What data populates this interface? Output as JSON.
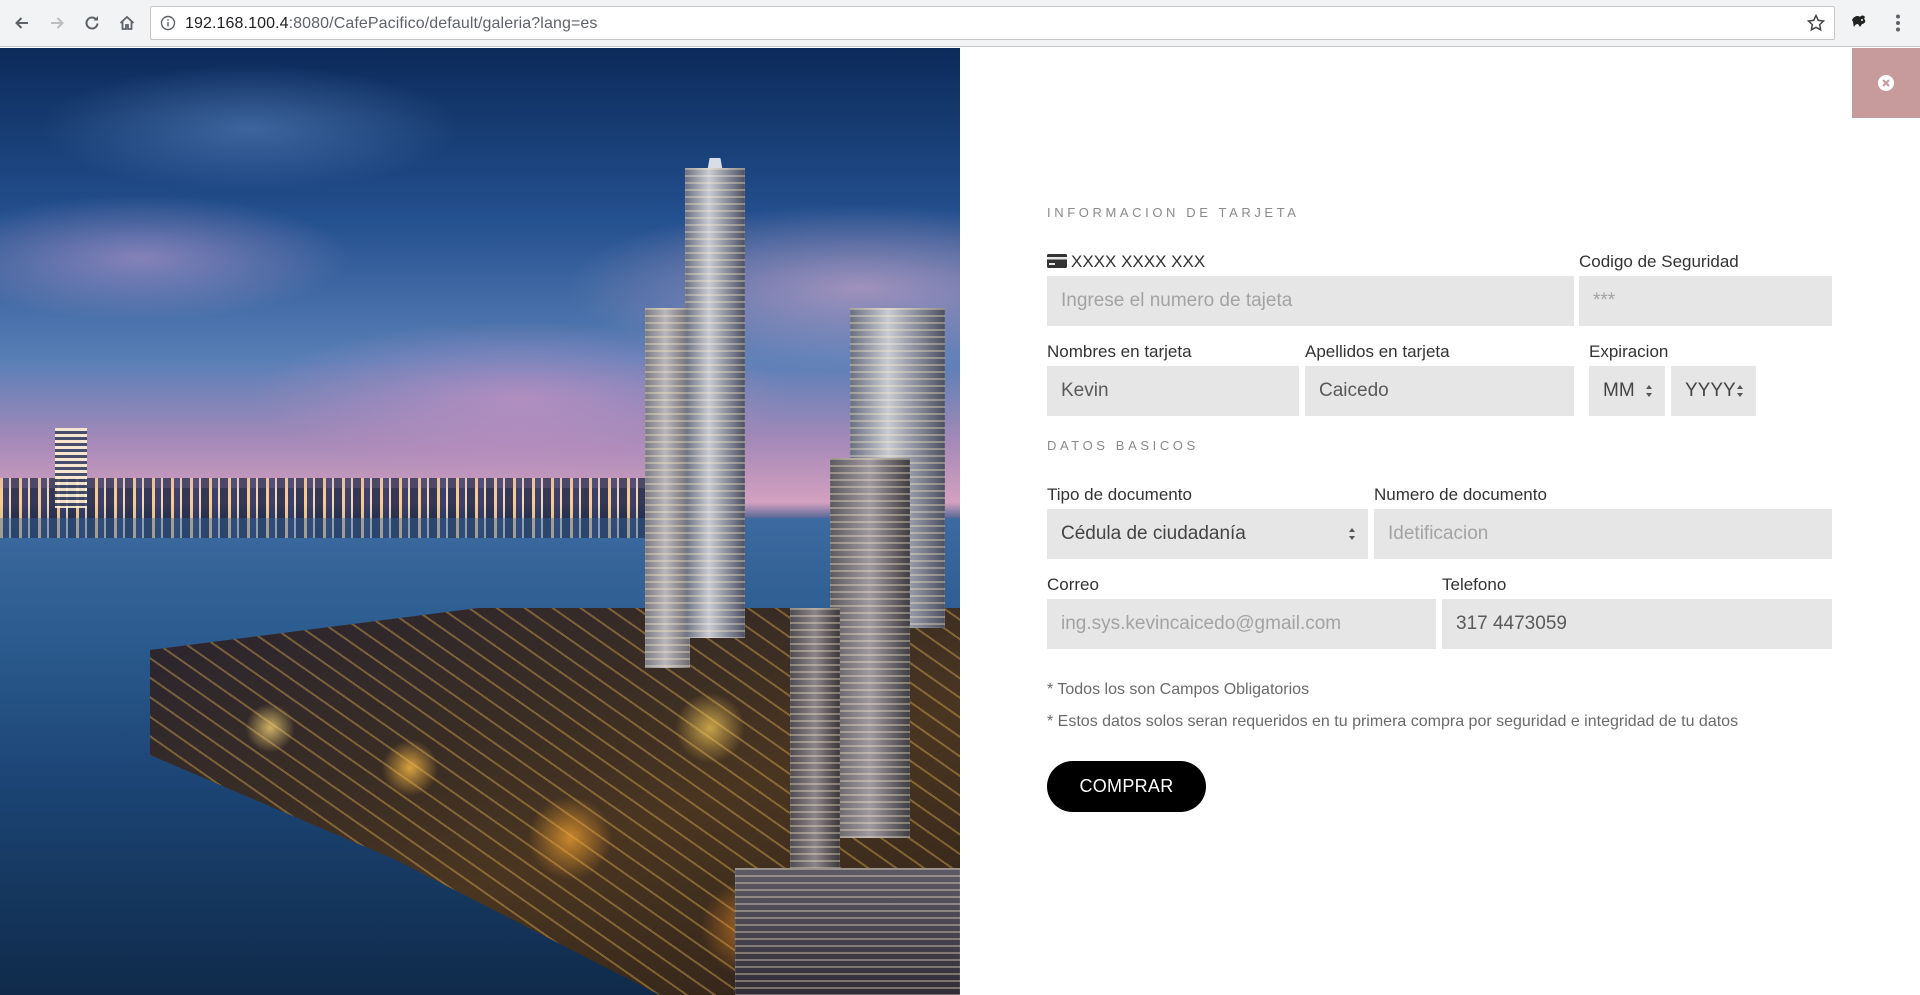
{
  "browser": {
    "url_host": "192.168.100.4",
    "url_rest": ":8080/CafePacifico/default/galeria?lang=es"
  },
  "card_section": {
    "title": "INFORMACION DE TARJETA",
    "card_number_label": "XXXX XXXX XXX",
    "card_number_placeholder": "Ingrese el numero de tajeta",
    "security_code_label": "Codigo de Seguridad",
    "security_code_placeholder": "***",
    "first_names_label": "Nombres en tarjeta",
    "first_names_value": "Kevin",
    "last_names_label": "Apellidos en tarjeta",
    "last_names_value": "Caicedo",
    "expiration_label": "Expiracion",
    "expiration_month": "MM",
    "expiration_year": "YYYY"
  },
  "basic_section": {
    "title": "DATOS BASICOS",
    "doc_type_label": "Tipo de documento",
    "doc_type_value": "Cédula de ciudadanía",
    "doc_number_label": "Numero de documento",
    "doc_number_placeholder": "Idetificacion",
    "email_label": "Correo",
    "email_placeholder": "ing.sys.kevincaicedo@gmail.com",
    "phone_label": "Telefono",
    "phone_value": "317 4473059"
  },
  "notes": [
    "* Todos los son Campos Obligatorios",
    "* Estos datos solos seran requeridos en tu primera compra por seguridad e integridad de tu datos"
  ],
  "buy_button": "COMPRAR",
  "colors": {
    "close_button": "#c79a9c",
    "field_bg": "#e6e6e6",
    "button_bg": "#000000"
  },
  "icons": [
    "back-arrow-icon",
    "forward-arrow-icon",
    "reload-icon",
    "home-icon",
    "info-icon",
    "star-icon",
    "extension-icon",
    "menu-dots-icon",
    "close-icon",
    "credit-card-icon"
  ]
}
